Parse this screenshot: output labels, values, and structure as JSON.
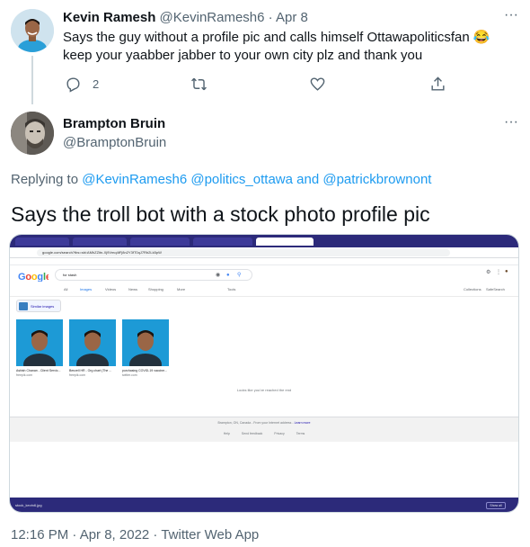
{
  "reply": {
    "name": "Kevin Ramesh",
    "handle": "@KevinRamesh6",
    "separator": "·",
    "date": "Apr 8",
    "text": "Says the guy without a profile pic and calls himself Ottawapoliticsfan 😂 keep your yaabber jabber to your own city plz and thank you",
    "reply_count": "2",
    "more": "···"
  },
  "main": {
    "name": "Brampton Bruin",
    "handle": "@BramptonBruin",
    "more": "···",
    "replying_prefix": "Replying to",
    "mention_1": "@KevinRamesh6",
    "mention_2": "@politics_ottawa",
    "and": "and",
    "mention_3": "@patrickbrownont",
    "text": "Says the troll bot with a stock photo profile pic",
    "timestamp": "12:16 PM · Apr 8, 2022 · Twitter Web App"
  },
  "screenshot": {
    "url": "google.com/search?tbs=sbi:AMhZZitn-Xj9Vmq4tFj8n2Y3fT0qJ7Rb2Lk5pW",
    "search_query": "for stash",
    "tabs": [
      "All",
      "Images",
      "Videos",
      "News",
      "Shopping",
      "More",
      "Tools"
    ],
    "active_tab": "Images",
    "right_links": [
      "Collections",
      "SafeSearch"
    ],
    "similar_label": "Similar images",
    "results": [
      {
        "caption": "Ashish Chanan - Client Servic...",
        "source": "freepik.com"
      },
      {
        "caption": "Benzell HR - Org chart (The ...",
        "source": "freepik.com"
      },
      {
        "caption": "purchasing COVID-19 vaccine...",
        "source": "twitter.com"
      }
    ],
    "end_message": "Looks like you've reached the end",
    "footer_location": "Brampton, ON, Canada - From your Internet address -",
    "footer_learn": "Learn more",
    "footer_links": [
      "Help",
      "Send feedback",
      "Privacy",
      "Terms"
    ],
    "download_item": "stock_kevin6.jpg",
    "show_all": "Show all"
  }
}
